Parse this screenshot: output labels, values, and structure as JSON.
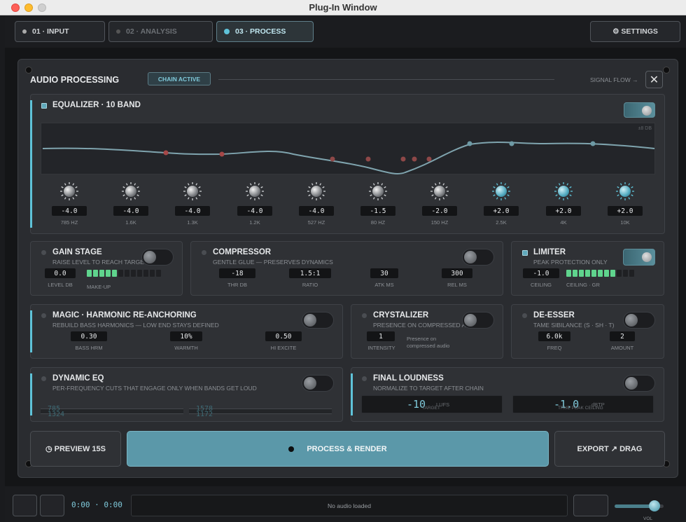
{
  "window": {
    "title": "Plug-In Window"
  },
  "tabs": [
    {
      "label": "01 · INPUT",
      "state": "normal"
    },
    {
      "label": "02 · ANALYSIS",
      "state": "dim"
    },
    {
      "label": "03 · PROCESS",
      "state": "active"
    }
  ],
  "settings_label": "⚙ SETTINGS",
  "panel": {
    "title": "AUDIO PROCESSING",
    "badge": "CHAIN ACTIVE",
    "signal_flow": "SIGNAL FLOW →",
    "close": "✕"
  },
  "eq": {
    "title": "EQUALIZER · 10 BAND",
    "unit": "±8 DB",
    "enabled": true,
    "bands": [
      {
        "value": "-4.0",
        "label": "785 HZ"
      },
      {
        "value": "-4.0",
        "label": "1.6K"
      },
      {
        "value": "-4.0",
        "label": "1.3K"
      },
      {
        "value": "-4.0",
        "label": "1.2K"
      },
      {
        "value": "-4.0",
        "label": "527 HZ"
      },
      {
        "value": "-1.5",
        "label": "80 HZ"
      },
      {
        "value": "-2.0",
        "label": "150 HZ"
      },
      {
        "value": "+2.0",
        "label": "2.5K"
      },
      {
        "value": "+2.0",
        "label": "4K"
      },
      {
        "value": "+2.0",
        "label": "10K"
      }
    ]
  },
  "gain": {
    "title": "GAIN STAGE",
    "subtitle": "RAISE LEVEL TO REACH TARGET LUFS",
    "value": "0.0",
    "value_label": "LEVEL DB",
    "meter_label": "MAKE-UP",
    "meter_lit": 5,
    "meter_total": 12
  },
  "compressor": {
    "title": "COMPRESSOR",
    "subtitle": "GENTLE GLUE — PRESERVES DYNAMICS",
    "params": [
      {
        "value": "-18",
        "label": "THR DB"
      },
      {
        "value": "1.5:1",
        "label": "RATIO"
      },
      {
        "value": "30",
        "label": "ATK MS"
      },
      {
        "value": "300",
        "label": "REL MS"
      }
    ]
  },
  "limiter": {
    "title": "LIMITER",
    "subtitle": "PEAK PROTECTION ONLY",
    "value": "-1.0",
    "value_label": "CEILING",
    "meter_label": "CEILING · GR",
    "meter_lit": 8,
    "meter_total": 11,
    "enabled": true
  },
  "magic": {
    "title": "MAGIC · HARMONIC RE-ANCHORING",
    "subtitle": "REBUILD BASS HARMONICS — LOW END STAYS DEFINED",
    "params": [
      {
        "value": "0.30",
        "label": "BASS HRM"
      },
      {
        "value": "10%",
        "label": "WARMTH"
      },
      {
        "value": "0.50",
        "label": "HI EXCITE"
      }
    ]
  },
  "crystalizer": {
    "title": "CRYSTALIZER",
    "subtitle": "PRESENCE ON COMPRESSED AUDIO",
    "value": "1",
    "value_label": "INTENSITY",
    "note_line1": "Presence on",
    "note_line2": "compressed audio"
  },
  "deesser": {
    "title": "DE-ESSER",
    "subtitle": "TAME SIBILANCE (S · SH · T)",
    "params": [
      {
        "value": "6.0k",
        "label": "FREQ"
      },
      {
        "value": "2",
        "label": "AMOUNT"
      }
    ]
  },
  "dyneq": {
    "title": "DYNAMIC EQ",
    "subtitle": "PER-FREQUENCY CUTS THAT ENGAGE ONLY WHEN BANDS GET LOUD",
    "left_top": "785",
    "left_bottom": "1324",
    "right_top": "1578",
    "right_bottom": "1172"
  },
  "loudness": {
    "title": "FINAL LOUDNESS",
    "subtitle": "NORMALIZE TO TARGET AFTER CHAIN",
    "target_value": "-10",
    "target_unit": "LUFS",
    "target_caption": "TARGET",
    "peak_value": "-1.0",
    "peak_unit": "dBTP",
    "peak_caption": "TRUE PEAK CEILING"
  },
  "actions": {
    "preview": "◷ PREVIEW 15S",
    "process": "PROCESS & RENDER",
    "export": "EXPORT ↗ DRAG"
  },
  "transport": {
    "time": "0:00 · 0:00",
    "status": "No audio loaded",
    "volume_label": "VOL",
    "volume": 0.82
  },
  "colors": {
    "accent": "#5fc3d9",
    "process_button": "#5b98a9",
    "meter_green": "#5fd48d"
  }
}
